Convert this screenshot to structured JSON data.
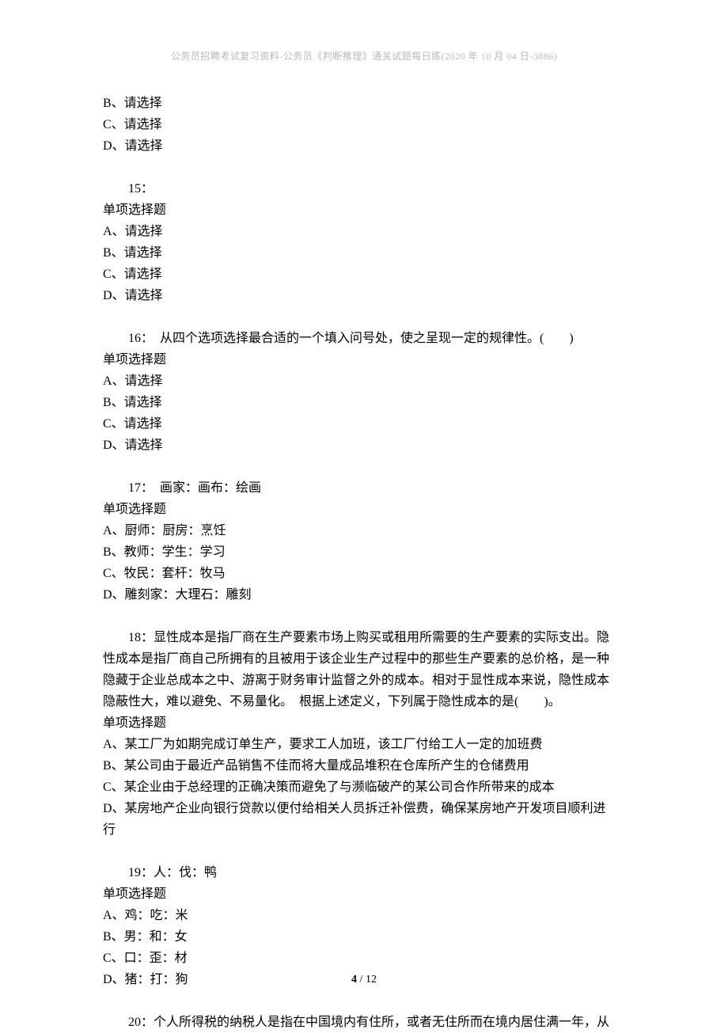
{
  "header": "公务员招聘考试复习资料-公务员《判断推理》通关试题每日练(2020 年 10 月 04 日-3886)",
  "q14": {
    "b": "B、请选择",
    "c": "C、请选择",
    "d": "D、请选择"
  },
  "q15": {
    "num": "15：",
    "type": "单项选择题",
    "a": "A、请选择",
    "b": "B、请选择",
    "c": "C、请选择",
    "d": "D、请选择"
  },
  "q16": {
    "num": "16：  从四个选项选择最合适的一个填入问号处，使之呈现一定的规律性。(　　)",
    "type": "单项选择题",
    "a": "A、请选择",
    "b": "B、请选择",
    "c": "C、请选择",
    "d": "D、请选择"
  },
  "q17": {
    "num": "17：  画家：画布：绘画",
    "type": "单项选择题",
    "a": "A、厨师：厨房：烹饪",
    "b": "B、教师：学生：学习",
    "c": "C、牧民：套杆：牧马",
    "d": "D、雕刻家：大理石：雕刻"
  },
  "q18": {
    "num": "18：显性成本是指厂商在生产要素市场上购买或租用所需要的生产要素的实际支出。隐",
    "l2": "性成本是指厂商自己所拥有的且被用于该企业生产过程中的那些生产要素的总价格，是一种",
    "l3": "隐藏于企业总成本之中、游离于财务审计监督之外的成本。相对于显性成本来说，隐性成本",
    "l4": "隐蔽性大，难以避免、不易量化。  根据上述定义，下列属于隐性成本的是(　　)。",
    "type": "单项选择题",
    "a": "A、某工厂为如期完成订单生产，要求工人加班，该工厂付给工人一定的加班费",
    "b": "B、某公司由于最近产品销售不佳而将大量成品堆积在仓库所产生的仓储费用",
    "c": "C、某企业由于总经理的正确决策而避免了与濒临破产的某公司合作所带来的成本",
    "d1": "D、某房地产企业向银行贷款以便付给相关人员拆迁补偿费，确保某房地产开发项目顺利进",
    "d2": "行"
  },
  "q19": {
    "num": "19：人：伐：鸭",
    "type": "单项选择题",
    "a": "A、鸡：吃：米",
    "b": "B、男：和：女",
    "c": "C、口：歪：材",
    "d": "D、猪：打：狗"
  },
  "q20": {
    "num": "20：个人所得税的纳税人是指在中国境内有住所，或者无住所而在境内居住满一年，从"
  },
  "footer": {
    "current": "4",
    "sep": " / ",
    "total": "12"
  }
}
